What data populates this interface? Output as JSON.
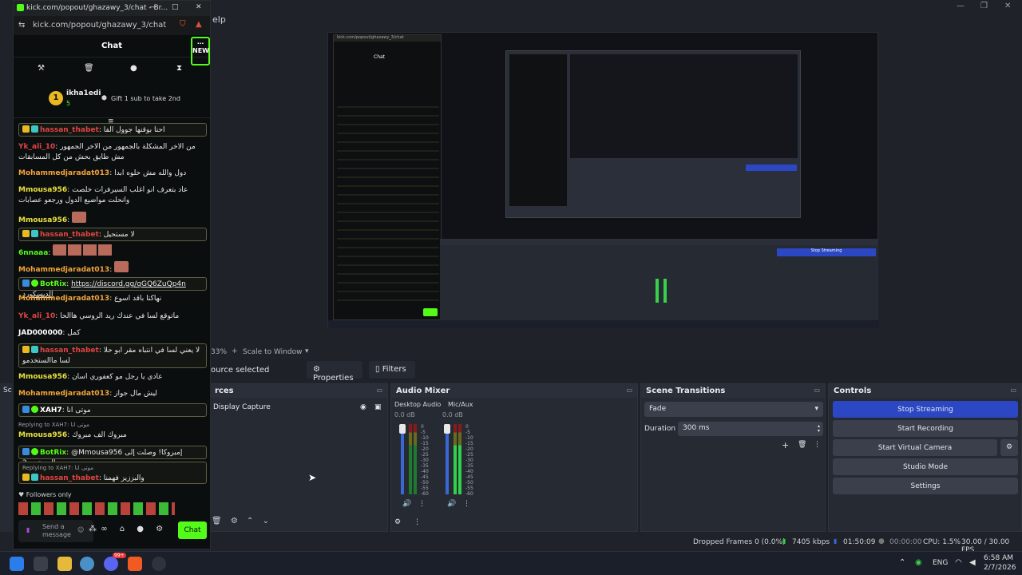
{
  "obs": {
    "menu_fragment": "elp",
    "preview_status": "33%",
    "scale_label": "Scale to Window",
    "no_source": "ource selected",
    "properties": "Properties",
    "filters": "Filters",
    "sources_title": "rces",
    "source_item": "Display Capture",
    "left_dock_labels": [
      "Sc",
      "ge",
      "S",
      "St"
    ],
    "audio_mixer": {
      "title": "Audio Mixer",
      "channels": [
        {
          "name": "Desktop Audio",
          "db": "0.0 dB"
        },
        {
          "name": "Mic/Aux",
          "db": "0.0 dB"
        }
      ],
      "scale": [
        "0",
        "-5",
        "-10",
        "-15",
        "-20",
        "-25",
        "-30",
        "-35",
        "-40",
        "-45",
        "-50",
        "-55",
        "-60"
      ]
    },
    "scene_transitions": {
      "title": "Scene Transitions",
      "transition": "Fade",
      "duration_label": "Duration",
      "duration": "300 ms"
    },
    "controls": {
      "title": "Controls",
      "buttons": [
        "Stop Streaming",
        "Start Recording",
        "Start Virtual Camera",
        "Studio Mode",
        "Settings"
      ]
    },
    "status": {
      "dropped": "Dropped Frames 0 (0.0%)",
      "kbps": "7405 kbps",
      "live_time": "01:50:09",
      "rec_time": "00:00:00",
      "cpu": "CPU: 1.5%",
      "fps": "30.00 / 30.00 FPS"
    }
  },
  "chat": {
    "tab_title": "kick.com/popout/ghazawy_3/chat - Br...",
    "url": "kick.com/popout/ghazawy_3/chat",
    "header": "Chat",
    "new_badge": "NEW",
    "top_gifter": {
      "rank": "1",
      "name": "ikha1edi",
      "count": "5",
      "gift_text": "Gift 1 sub to take 2nd"
    },
    "messages": [
      {
        "user": "hassan_thabet",
        "color": "red",
        "text": "احنا بوقنها جوول الفا",
        "hl": true
      },
      {
        "user": "Yk_ali_10",
        "color": "red",
        "text": "من الاخر المشكلة بالجمهور من الاخر الجمهور مش طايق بحش من كل المسابقات",
        "hl": false
      },
      {
        "user": "Mohammedjaradat013",
        "color": "orange",
        "text": "دول والله مش حلوه ابدا",
        "hl": false
      },
      {
        "user": "Mmousa956",
        "color": "yellow",
        "text": "عاد بتعرف انو اغلب السيرفرات خلصت وانحلت مواضيع الدول ورجعو عصابات",
        "hl": false
      },
      {
        "user": "Mmousa956",
        "color": "yellow",
        "text": "",
        "hl": false
      },
      {
        "user": "hassan_thabet",
        "color": "red",
        "text": "لا مستحيل",
        "hl": true
      },
      {
        "user": "6nnaaa",
        "color": "green",
        "text": "",
        "hl": false
      },
      {
        "user": "Mohammedjaradat013",
        "color": "orange",
        "text": "",
        "hl": false
      },
      {
        "user": "BotRix",
        "color": "green",
        "text": "https://discord.gg/qGQ6ZuQp4n الديسكورد",
        "hl": true
      },
      {
        "user": "Mohammedjaradat013",
        "color": "orange",
        "text": "نهاكتا باقد اسوع",
        "hl": false
      },
      {
        "user": "Yk_ali_10",
        "color": "red",
        "text": "ماتوقع لسا في عندك ريد الروسي هاالحا",
        "hl": false
      },
      {
        "user": "JAD000000",
        "color": "white",
        "text": "كمل",
        "hl": false
      },
      {
        "user": "hassan_thabet",
        "color": "red",
        "text": "لا يعني لسا في انتباه مقر ابو حلا لسا ماالستخدمو",
        "hl": true
      },
      {
        "user": "Mmousa956",
        "color": "yellow",
        "text": "عادي يا رجل مو كعفوري اسان",
        "hl": false
      },
      {
        "user": "Mohammedjaradat013",
        "color": "orange",
        "text": "ليش مال جواز",
        "hl": false
      },
      {
        "user": "XAH7",
        "color": "white",
        "text": "موتى انا",
        "hl": true
      },
      {
        "user": "Mmousa956",
        "color": "yellow",
        "text": "مبروك الف مبروك",
        "hl": false,
        "reply": "Replying to XAH7: موتى انا"
      },
      {
        "user": "BotRix",
        "color": "green",
        "text": "@Mmousa956 إمبروكا! وصلت إلى المستوى 2",
        "hl": true
      },
      {
        "user": "hassan_thabet",
        "color": "red",
        "text": "والبززيز فهمنا",
        "hl": true,
        "reply": "Replying to XAH7: موتى انا"
      }
    ],
    "followers_only": "Followers only",
    "input_placeholder": "Send a message",
    "send_label": "Chat"
  },
  "taskbar": {
    "lang": "ENG",
    "time": "6:58 AM",
    "date": "2/7/2026",
    "badge": "99+"
  },
  "colors": {
    "kick_green": "#53fc18",
    "obs_blue": "#2b47c4",
    "red_user": "#e04444"
  }
}
